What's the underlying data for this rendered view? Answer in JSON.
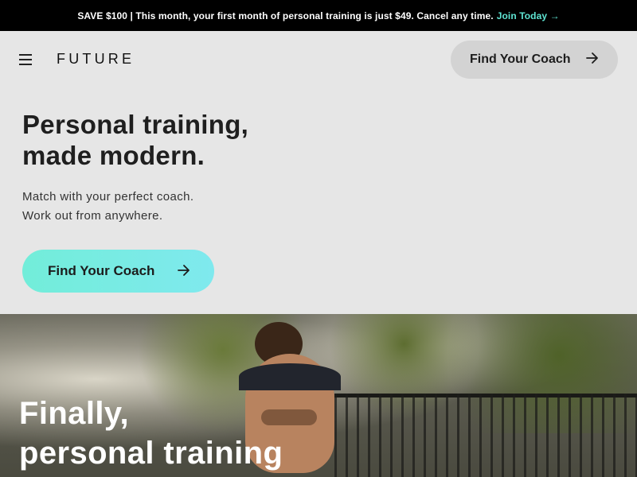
{
  "promo": {
    "text": "SAVE $100 | This month, your first month of personal training is just $49. Cancel any time.",
    "link": "Join Today →"
  },
  "header": {
    "logo": "FUTURE",
    "cta_label": "Find Your Coach"
  },
  "hero": {
    "title_line1": "Personal training,",
    "title_line2": "made modern.",
    "sub_line1": "Match with your perfect coach.",
    "sub_line2": "Work out from anywhere.",
    "cta_label": "Find Your Coach"
  },
  "photo_section": {
    "title_line1": "Finally,",
    "title_line2": "personal training"
  },
  "icons": {
    "menu": "hamburger-menu-icon",
    "arrow": "arrow-right-icon"
  },
  "colors": {
    "promo_link": "#5fe5d3",
    "cta_gradient_start": "#72edd9",
    "cta_gradient_end": "#7fe9ee",
    "page_bg": "#e6e6e6"
  }
}
